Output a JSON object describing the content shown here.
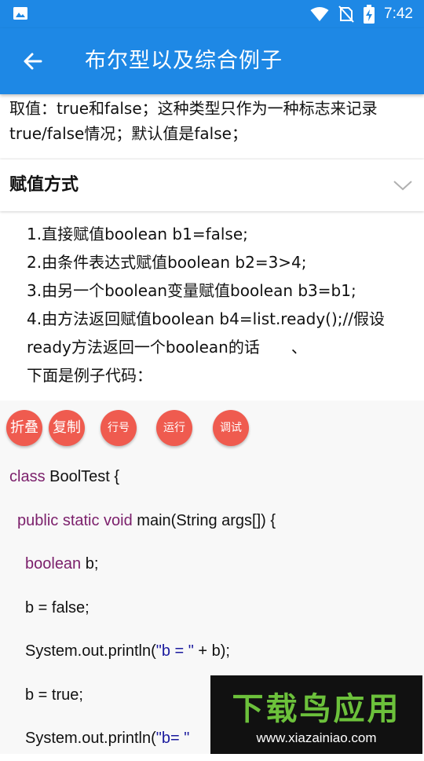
{
  "status_bar": {
    "time": "7:42",
    "icons": [
      "image-icon",
      "wifi-icon",
      "no-sim-icon",
      "battery-charging-icon"
    ]
  },
  "app_bar": {
    "title": "布尔型以及综合例子",
    "back_icon": "arrow-back-icon"
  },
  "intro": {
    "text": "取值：true和false；这种类型只作为一种标志来记录true/false情况；默认值是false；"
  },
  "section": {
    "title": "赋值方式",
    "expand_icon": "chevron-down-icon"
  },
  "methods": {
    "items": [
      "1.直接赋值boolean b1=false;",
      "2.由条件表达式赋值boolean b2=3>4;",
      "3.由另一个boolean变量赋值boolean b3=b1;",
      "4.由方法返回赋值boolean b4=list.ready();//假设ready方法返回一个boolean的话　　、",
      "下面是例子代码："
    ]
  },
  "toolbar": {
    "fold": "折叠",
    "copy": "复制",
    "line_numbers": "行号",
    "run": "运行",
    "debug": "调试"
  },
  "code": {
    "l1_kw": "class",
    "l1_rest": " BoolTest {",
    "l2_kw": "public static void",
    "l2_rest": " main(String args[]) {",
    "l3_kw": "boolean",
    "l3_rest": " b;",
    "l4": "b = false;",
    "l5_pre": "System.out.println(",
    "l5_str": "\"b = \"",
    "l5_post": " + b);",
    "l6": "b = true;",
    "l7_pre": "System.out.println(",
    "l7_str": "\"b= \""
  },
  "watermark": {
    "name": "下载鸟应用",
    "url": "www.xiazainiao.com"
  },
  "colors": {
    "primary": "#1e88e5",
    "button": "#ef5b4f",
    "keyword": "#7b1f6b",
    "string": "#1a1a9e"
  }
}
